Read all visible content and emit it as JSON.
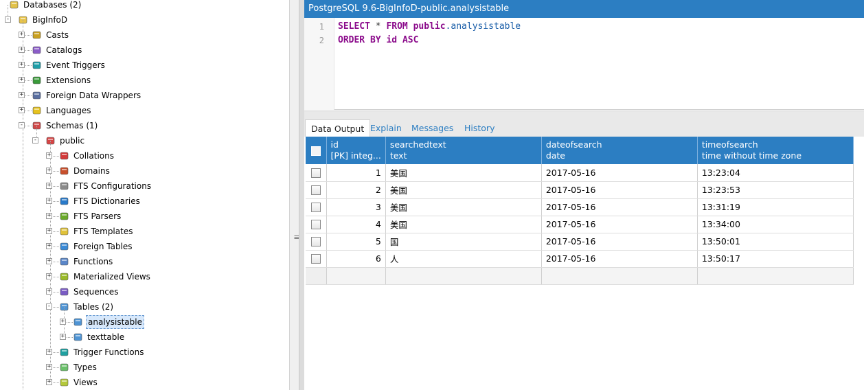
{
  "tree": {
    "databases_label": "Databases (2)",
    "db_label": "BigInfoD",
    "db_children": [
      {
        "label": "Casts",
        "icon": "casts-icon"
      },
      {
        "label": "Catalogs",
        "icon": "catalogs-icon"
      },
      {
        "label": "Event Triggers",
        "icon": "event-triggers-icon"
      },
      {
        "label": "Extensions",
        "icon": "extensions-icon"
      },
      {
        "label": "Foreign Data Wrappers",
        "icon": "foreign-data-wrappers-icon"
      },
      {
        "label": "Languages",
        "icon": "languages-icon"
      },
      {
        "label": "Schemas (1)",
        "icon": "schemas-icon"
      }
    ],
    "schema_label": "public",
    "schema_children": [
      {
        "label": "Collations",
        "icon": "collations-icon"
      },
      {
        "label": "Domains",
        "icon": "domains-icon"
      },
      {
        "label": "FTS Configurations",
        "icon": "fts-configurations-icon"
      },
      {
        "label": "FTS Dictionaries",
        "icon": "fts-dictionaries-icon"
      },
      {
        "label": "FTS Parsers",
        "icon": "fts-parsers-icon"
      },
      {
        "label": "FTS Templates",
        "icon": "fts-templates-icon"
      },
      {
        "label": "Foreign Tables",
        "icon": "foreign-tables-icon"
      },
      {
        "label": "Functions",
        "icon": "functions-icon"
      },
      {
        "label": "Materialized Views",
        "icon": "materialized-views-icon"
      },
      {
        "label": "Sequences",
        "icon": "sequences-icon"
      },
      {
        "label": "Tables (2)",
        "icon": "tables-icon"
      }
    ],
    "tables": [
      {
        "label": "analysistable",
        "selected": true
      },
      {
        "label": "texttable",
        "selected": false
      }
    ],
    "after_tables": [
      {
        "label": "Trigger Functions",
        "icon": "trigger-functions-icon"
      },
      {
        "label": "Types",
        "icon": "types-icon"
      },
      {
        "label": "Views",
        "icon": "views-icon"
      }
    ]
  },
  "editor": {
    "title": "PostgreSQL 9.6-BigInfoD-public.analysistable",
    "line_numbers": [
      "1",
      "2"
    ],
    "line1": {
      "kw1": "SELECT",
      "op": "*",
      "kw2": "FROM",
      "schema": "public",
      "dot": ".",
      "table": "analysistable"
    },
    "line2": {
      "kw1": "ORDER BY",
      "col": "id",
      "kw2": "ASC"
    }
  },
  "tabs": [
    "Data Output",
    "Explain",
    "Messages",
    "History"
  ],
  "grid": {
    "columns": [
      {
        "name": "id",
        "type": "[PK] integ..."
      },
      {
        "name": "searchedtext",
        "type": "text"
      },
      {
        "name": "dateofsearch",
        "type": "date"
      },
      {
        "name": "timeofsearch",
        "type": "time without time zone"
      }
    ],
    "rows": [
      [
        "1",
        "美国",
        "2017-05-16",
        "13:23:04"
      ],
      [
        "2",
        "美国",
        "2017-05-16",
        "13:23:53"
      ],
      [
        "3",
        "美国",
        "2017-05-16",
        "13:31:19"
      ],
      [
        "4",
        "美国",
        "2017-05-16",
        "13:34:00"
      ],
      [
        "5",
        "国",
        "2017-05-16",
        "13:50:01"
      ],
      [
        "6",
        "人",
        "2017-05-16",
        "13:50:17"
      ]
    ]
  },
  "colors": {
    "accent": "#2c7ec2",
    "keyword": "#8b0b8b",
    "identifier": "#1a5ea8"
  }
}
